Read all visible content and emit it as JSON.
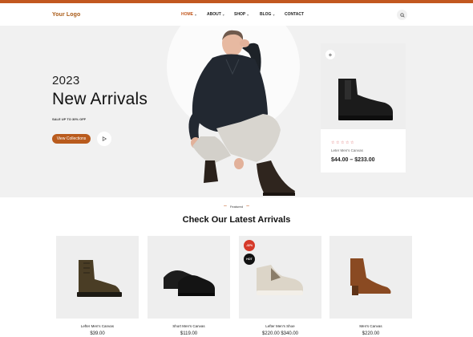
{
  "header": {
    "logo": "Your Logo",
    "nav": [
      {
        "label": "HOME",
        "active": true,
        "has_dropdown": true
      },
      {
        "label": "ABOUT",
        "active": false,
        "has_dropdown": true
      },
      {
        "label": "SHOP",
        "active": false,
        "has_dropdown": true
      },
      {
        "label": "BLOG",
        "active": false,
        "has_dropdown": true
      },
      {
        "label": "CONTACT",
        "active": false,
        "has_dropdown": false
      }
    ],
    "search_icon": "search-icon"
  },
  "hero": {
    "year": "2023",
    "title": "New Arrivals",
    "subtitle": "SALE UP TO 30% OFF",
    "cta": "View Collections",
    "play_icon": "play-icon"
  },
  "hero_card": {
    "add_icon": "plus-icon",
    "rating": "0 of 5",
    "name": "Leter Men's Canvas",
    "price": "$44.00 – $233.00"
  },
  "featured": {
    "eyebrow": "Featured",
    "title": "Check Our Latest Arrivals"
  },
  "products": [
    {
      "name": "Lefter Men's Canvas",
      "price": "$39.00",
      "badges": []
    },
    {
      "name": "Short Men's Canvas",
      "price": "$119.00",
      "badges": []
    },
    {
      "name": "Lefter Men's Shoe",
      "price": "$220.00  $340.00",
      "badges": [
        "-32%",
        "HOT"
      ]
    },
    {
      "name": "Men's Canvas",
      "price": "$220.00",
      "badges": []
    }
  ],
  "colors": {
    "accent": "#c2581f",
    "hero_bg": "#f1f1f1",
    "sale_badge": "#d63a2a",
    "hot_badge": "#111111",
    "star": "#d23b3b"
  }
}
